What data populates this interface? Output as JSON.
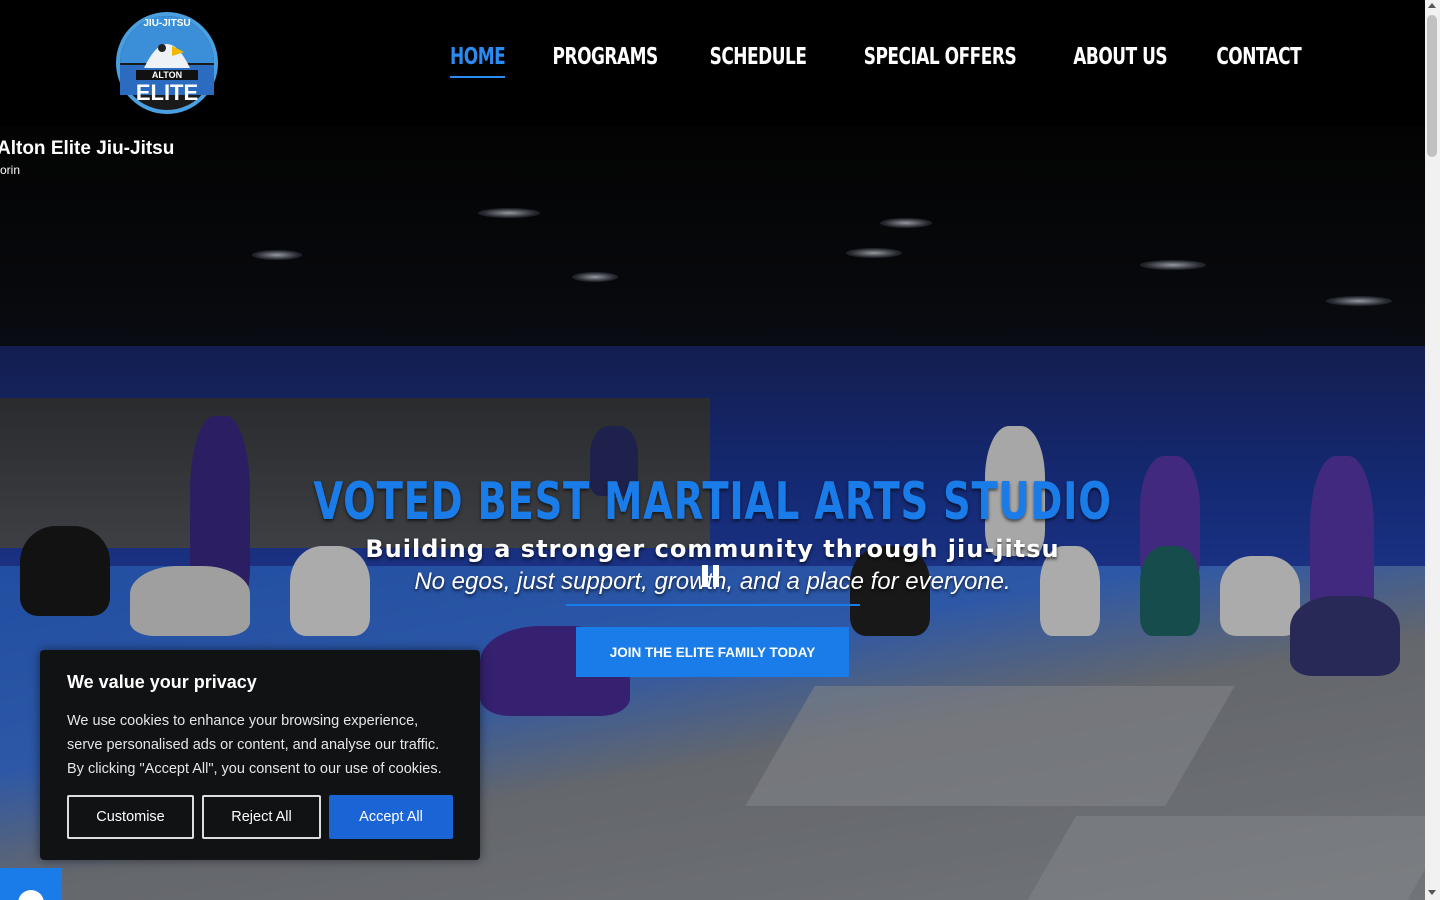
{
  "header": {
    "logo": {
      "top_text": "JIU-JITSU",
      "middle_text": "ALTON",
      "bottom_text": "ELITE"
    },
    "nav": [
      {
        "label": "HOME",
        "active": true
      },
      {
        "label": "PROGRAMS",
        "active": false
      },
      {
        "label": "SCHEDULE",
        "active": false
      },
      {
        "label": "SPECIAL OFFERS",
        "active": false
      },
      {
        "label": "ABOUT US",
        "active": false
      },
      {
        "label": "CONTACT",
        "active": false
      }
    ]
  },
  "video": {
    "title": "Alton Elite Jiu-Jitsu",
    "subtitle": "orin"
  },
  "hero": {
    "headline": "VOTED BEST MARTIAL ARTS STUDIO",
    "subheadline": "Building a stronger community through jiu-jitsu",
    "tagline": "No egos, just support, growth, and a place for everyone.",
    "cta_label": "JOIN THE ELITE FAMILY TODAY"
  },
  "cookie_banner": {
    "title": "We value your privacy",
    "text": "We use cookies to enhance your browsing experience, serve personalised ads or content, and analyse our traffic. By clicking \"Accept All\", you consent to our use of cookies.",
    "customise_label": "Customise",
    "reject_label": "Reject All",
    "accept_label": "Accept All"
  },
  "social": {
    "facebook_icon": "facebook-icon"
  },
  "colors": {
    "accent": "#1a7ce8",
    "header_bg": "#000000",
    "cookie_bg": "#111214"
  }
}
